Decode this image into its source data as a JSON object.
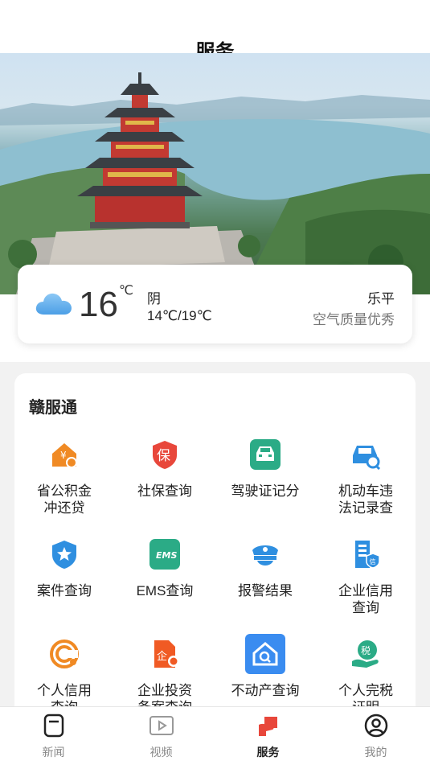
{
  "header": {
    "title": "服务"
  },
  "weather": {
    "temperature": "16",
    "unit": "℃",
    "condition": "阴",
    "range": "14℃/19℃",
    "city": "乐平",
    "air_quality": "空气质量优秀",
    "icon": "cloud-icon"
  },
  "services": {
    "title": "赣服通",
    "items": [
      {
        "label": "省公积金冲还贷",
        "icon": "housing-fund-icon",
        "color": "#f08a24"
      },
      {
        "label": "社保查询",
        "icon": "social-security-shield-icon",
        "color": "#e8473b"
      },
      {
        "label": "驾驶证记分",
        "icon": "driver-license-car-icon",
        "color": "#2bab86"
      },
      {
        "label": "机动车违法记录查",
        "icon": "vehicle-search-icon",
        "color": "#2f8fe0"
      },
      {
        "label": "案件查询",
        "icon": "police-badge-icon",
        "color": "#2f8fe0"
      },
      {
        "label": "EMS查询",
        "icon": "ems-icon",
        "color": "#2bab86"
      },
      {
        "label": "报警结果",
        "icon": "police-cap-icon",
        "color": "#2f8fe0"
      },
      {
        "label": "企业信用查询",
        "icon": "enterprise-credit-icon",
        "color": "#2f8fe0"
      },
      {
        "label": "个人信用查询",
        "icon": "personal-credit-icon",
        "color": "#f08a24"
      },
      {
        "label": "企业投资备案查询",
        "icon": "enterprise-invest-icon",
        "color": "#f05a24"
      },
      {
        "label": "不动产查询",
        "icon": "real-estate-icon",
        "color": "#3a8cf0"
      },
      {
        "label": "个人完税证明",
        "icon": "tax-certificate-icon",
        "color": "#2bab86"
      }
    ]
  },
  "nav": {
    "items": [
      {
        "label": "新闻",
        "icon": "news-icon",
        "active": false
      },
      {
        "label": "视频",
        "icon": "video-icon",
        "active": false
      },
      {
        "label": "服务",
        "icon": "service-icon",
        "active": true
      },
      {
        "label": "我的",
        "icon": "profile-icon",
        "active": false
      }
    ]
  }
}
